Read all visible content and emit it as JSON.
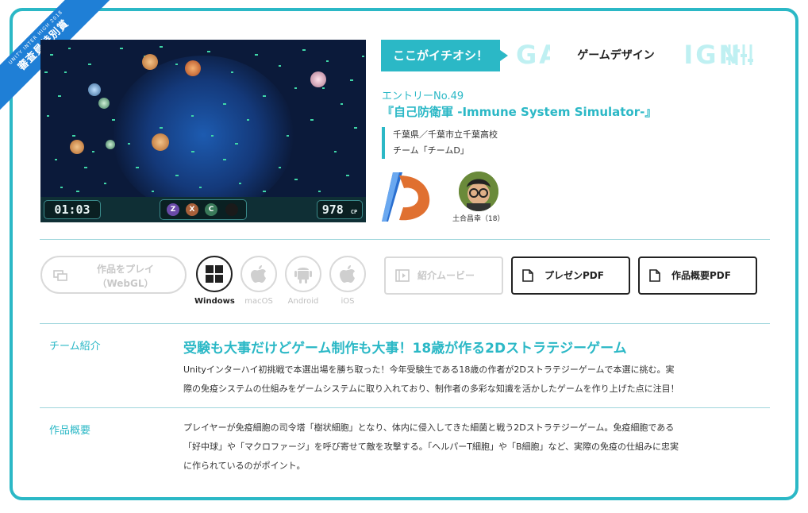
{
  "ribbon": {
    "small": "UNITY INTER HIGH 2018",
    "big": "審査員特別賞",
    "color": "#1f7fd6"
  },
  "screenshot": {
    "timer": "01:03",
    "score": "978",
    "score_unit": "CP",
    "keys": [
      "Z",
      "X",
      "C"
    ]
  },
  "category": {
    "pick_label": "ここがイチオシ！",
    "background_text": "GAME DESIGN",
    "label": "ゲームデザイン",
    "accent": "#2bb8c6"
  },
  "entry": {
    "number": "エントリーNo.49",
    "title": "『自己防衛軍 -Immune System Simulator-』",
    "school": "千葉県／千葉市立千葉高校",
    "team": "チーム「チームD」"
  },
  "member": {
    "name": "土合昌幸（18）"
  },
  "play": {
    "label_line1": "作品をプレイ",
    "label_line2": "（WebGL）"
  },
  "platforms": [
    {
      "name": "Windows",
      "icon": "windows-icon",
      "active": true
    },
    {
      "name": "macOS",
      "icon": "apple-icon",
      "active": false
    },
    {
      "name": "Android",
      "icon": "android-icon",
      "active": false
    },
    {
      "name": "iOS",
      "icon": "apple-icon",
      "active": false
    }
  ],
  "buttons": {
    "movie": "紹介ムービー",
    "presen_pdf": "プレゼンPDF",
    "summary_pdf": "作品概要PDF"
  },
  "team_intro": {
    "label": "チーム紹介",
    "headline": "受験も大事だけどゲーム制作も大事！18歳が作る2Dストラテジーゲーム",
    "body_line1": "Unityインターハイ初挑戦で本選出場を勝ち取った！今年受験生である18歳の作者が2Dストラテジーゲームで本選に挑む。実",
    "body_line2": "際の免疫システムの仕組みをゲームシステムに取り入れており、制作者の多彩な知識を活かしたゲームを作り上げた点に注目！"
  },
  "overview": {
    "label": "作品概要",
    "body_line1": "プレイヤーが免疫細胞の司令塔「樹状細胞」となり、体内に侵入してきた細菌と戦う2Dストラテジーゲーム。免疫細胞である",
    "body_line2": "「好中球」や「マクロファージ」を呼び寄せて敵を攻撃する。「ヘルパーT細胞」や「B細胞」など、実際の免疫の仕組みに忠実",
    "body_line3": "に作られているのがポイント。"
  }
}
